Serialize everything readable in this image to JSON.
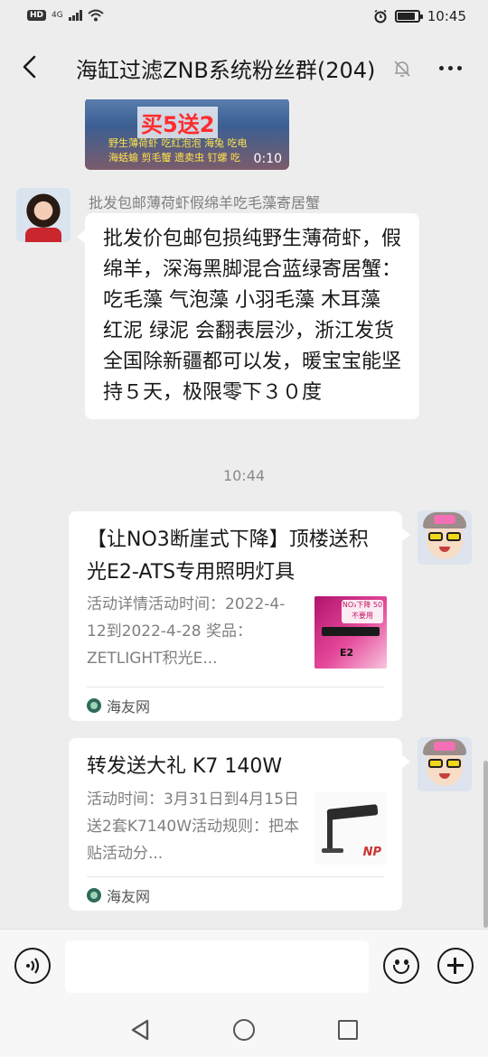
{
  "status_bar": {
    "hd_badge": "HD",
    "network": "4G",
    "time": "10:45",
    "battery_level": 0.85
  },
  "header": {
    "title": "海缸过滤ZNB系统粉丝群(204)"
  },
  "messages": {
    "video": {
      "promo_text": "买5送2",
      "caption_line1": "野生薄荷虾  吃红泡泡  海兔  吃电",
      "caption_line2": "海蛞蝓  剪毛蟹  遗卖虫  钉螺  吃",
      "duration": "0:10"
    },
    "text_message": {
      "sender": "批发包邮薄荷虾假绵羊吃毛藻寄居蟹",
      "content": "批发价包邮包损纯野生薄荷虾，假绵羊，深海黑脚混合蓝绿寄居蟹：吃毛藻 气泡藻 小羽毛藻 木耳藻 红泥 绿泥 会翻表层沙，浙江发货全国除新疆都可以发，暖宝宝能坚持５天，极限零下３０度"
    },
    "timestamp": "10:44",
    "link_card_1": {
      "title": "【让NO3断崖式下降】顶楼送积光E2-ATS专用照明灯具",
      "description": "活动详情活动时间：2022-4-12到2022-4-28 奖品：ZETLIGHT积光E...",
      "source": "海友网",
      "thumb_badge": "NO₃下降 50不要用",
      "thumb_label": "E2"
    },
    "link_card_2": {
      "title": "转发送大礼 K7 140W",
      "description": "活动时间：3月31日到4月15日送2套K7140W活动规则：把本贴活动分...",
      "source": "海友网",
      "thumb_brand": "NP"
    }
  },
  "input_bar": {
    "message_value": ""
  },
  "icons": {
    "back": "chevron-left-icon",
    "mute": "bell-off-icon",
    "more": "more-horizontal-icon",
    "voice": "voice-icon",
    "emoji": "emoji-icon",
    "plus": "plus-icon",
    "source": "haiyou-logo-icon"
  }
}
